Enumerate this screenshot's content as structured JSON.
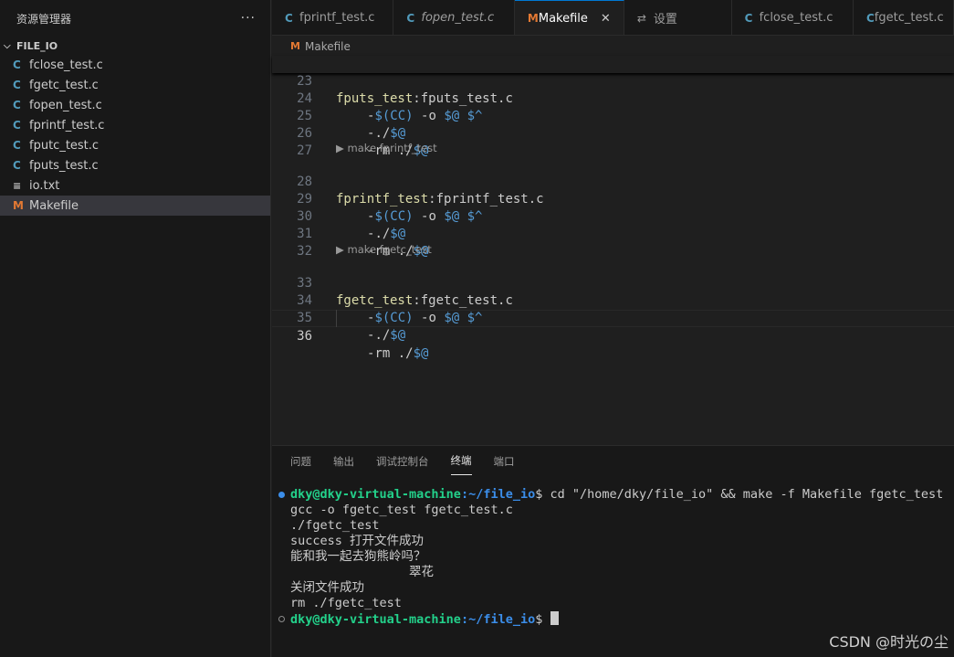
{
  "sidebar": {
    "title": "资源管理器",
    "more": "···",
    "folder": "FILE_IO",
    "files": [
      {
        "name": "fclose_test.c",
        "icon": "C"
      },
      {
        "name": "fgetc_test.c",
        "icon": "C"
      },
      {
        "name": "fopen_test.c",
        "icon": "C"
      },
      {
        "name": "fprintf_test.c",
        "icon": "C"
      },
      {
        "name": "fputc_test.c",
        "icon": "C"
      },
      {
        "name": "fputs_test.c",
        "icon": "C"
      },
      {
        "name": "io.txt",
        "icon": "≡"
      },
      {
        "name": "Makefile",
        "icon": "M"
      }
    ]
  },
  "tabs": [
    {
      "label": "fprintf_test.c",
      "icon": "C"
    },
    {
      "label": "fopen_test.c",
      "icon": "C"
    },
    {
      "label": "Makefile",
      "icon": "M",
      "close": "✕"
    },
    {
      "label": "设置",
      "icon": "⇄"
    },
    {
      "label": "fclose_test.c",
      "icon": "C"
    },
    {
      "label": "fgetc_test.c",
      "icon": "C"
    }
  ],
  "breadcrumb": {
    "icon": "M",
    "label": "Makefile"
  },
  "editor": {
    "sticky": {
      "num": "23",
      "target": "fputs_test",
      "deps": ":fputs_test.c"
    },
    "lines": [
      {
        "num": "24",
        "a": "-",
        "b": "$(CC)",
        "c": " -o ",
        "d": "$@",
        "e": " ",
        "f": "$^"
      },
      {
        "num": "25",
        "a": "-",
        "b": "./",
        "d": "$@"
      },
      {
        "num": "26",
        "a": "-",
        "b": "rm ./",
        "d": "$@"
      },
      {
        "num": "27"
      },
      {
        "lens": "▶ make fprintf_test"
      },
      {
        "num": "28",
        "target": "fprintf_test",
        "deps": ":fprintf_test.c"
      },
      {
        "num": "29",
        "a": "-",
        "b": "$(CC)",
        "c": " -o ",
        "d": "$@",
        "e": " ",
        "f": "$^"
      },
      {
        "num": "30",
        "a": "-",
        "b": "./",
        "d": "$@"
      },
      {
        "num": "31",
        "a": "-",
        "b": "rm ./",
        "d": "$@"
      },
      {
        "num": "32"
      },
      {
        "lens": "▶ make fgetc_test"
      },
      {
        "num": "33",
        "target": "fgetc_test",
        "deps": ":fgetc_test.c"
      },
      {
        "num": "34",
        "a": "-",
        "b": "$(CC)",
        "c": " -o ",
        "d": "$@",
        "e": " ",
        "f": "$^"
      },
      {
        "num": "35",
        "a": "-",
        "b": "./",
        "d": "$@"
      },
      {
        "num": "36",
        "a": "-",
        "b": "rm ./",
        "d": "$@"
      }
    ]
  },
  "panel": {
    "tabs": [
      "问题",
      "输出",
      "调试控制台",
      "终端",
      "端口"
    ],
    "terminal": {
      "prompt_user": "dky@dky-virtual-machine",
      "prompt_path": ":~/file_io",
      "prompt_end": "$",
      "command": " cd \"/home/dky/file_io\" && make -f Makefile fgetc_test",
      "output": [
        "gcc -o fgetc_test fgetc_test.c",
        "./fgetc_test",
        "success 打开文件成功",
        "能和我一起去狗熊岭吗？",
        "                翠花",
        "关闭文件成功",
        "rm ./fgetc_test"
      ]
    }
  },
  "watermark": "CSDN @时光の尘"
}
